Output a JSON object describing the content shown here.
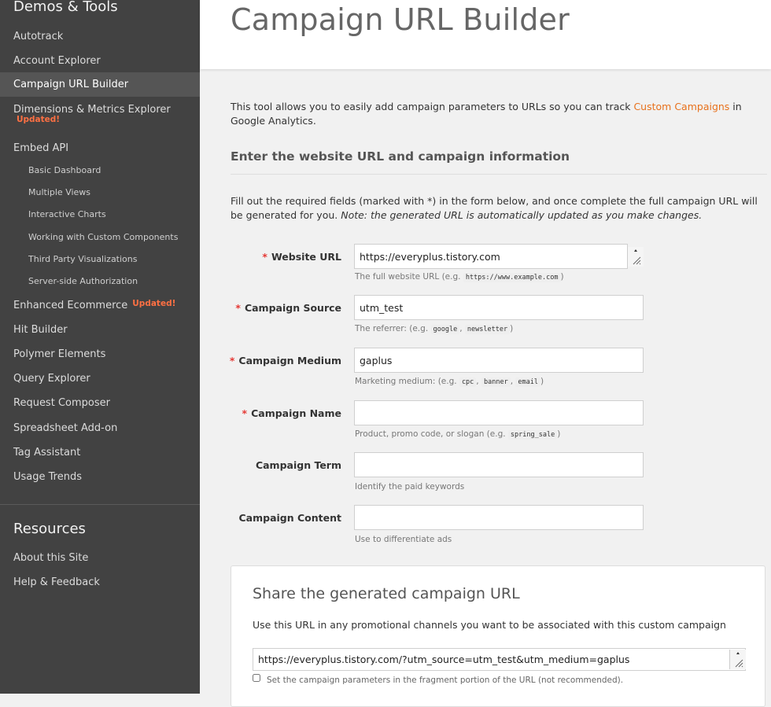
{
  "sidebar": {
    "demos_heading": "Demos & Tools",
    "items": {
      "autotrack": "Autotrack",
      "account_explorer": "Account Explorer",
      "campaign_url_builder": "Campaign URL Builder",
      "dimensions_metrics": "Dimensions & Metrics Explorer",
      "dimensions_badge": "Updated!",
      "embed_api": "Embed API",
      "enhanced_ecommerce": "Enhanced Ecommerce",
      "enhanced_badge": "Updated!",
      "hit_builder": "Hit Builder",
      "polymer_elements": "Polymer Elements",
      "query_explorer": "Query Explorer",
      "request_composer": "Request Composer",
      "spreadsheet_addon": "Spreadsheet Add-on",
      "tag_assistant": "Tag Assistant",
      "usage_trends": "Usage Trends"
    },
    "embed_sub": {
      "basic_dashboard": "Basic Dashboard",
      "multiple_views": "Multiple Views",
      "interactive_charts": "Interactive Charts",
      "custom_components": "Working with Custom Components",
      "third_party": "Third Party Visualizations",
      "server_side": "Server-side Authorization"
    },
    "resources_heading": "Resources",
    "resources": {
      "about": "About this Site",
      "help": "Help & Feedback"
    }
  },
  "header": {
    "title": "Campaign URL Builder"
  },
  "intro": {
    "text_before": "This tool allows you to easily add campaign parameters to URLs so you can track ",
    "link": "Custom Campaigns",
    "text_after": " in Google Analytics."
  },
  "form": {
    "heading": "Enter the website URL and campaign information",
    "instructions": "Fill out the required fields (marked with *) in the form below, and once complete the full campaign URL will be generated for you. ",
    "instructions_note": "Note: the generated URL is automatically updated as you make changes.",
    "required_mark": "*",
    "website_url": {
      "label": "Website URL",
      "value": "https://everyplus.tistory.com",
      "hint_prefix": "The full website URL (e.g. ",
      "hint_example": "https://www.example.com",
      "hint_suffix": ")"
    },
    "campaign_source": {
      "label": "Campaign Source",
      "value": "utm_test",
      "hint_prefix": "The referrer: (e.g. ",
      "hint_ex1": "google",
      "hint_sep": ", ",
      "hint_ex2": "newsletter",
      "hint_suffix": ")"
    },
    "campaign_medium": {
      "label": "Campaign Medium",
      "value": "gaplus",
      "hint_prefix": "Marketing medium: (e.g. ",
      "hint_ex1": "cpc",
      "hint_sep1": ", ",
      "hint_ex2": "banner",
      "hint_sep2": ", ",
      "hint_ex3": "email",
      "hint_suffix": ")"
    },
    "campaign_name": {
      "label": "Campaign Name",
      "value": "",
      "hint_prefix": "Product, promo code, or slogan (e.g. ",
      "hint_example": "spring_sale",
      "hint_suffix": ")"
    },
    "campaign_term": {
      "label": "Campaign Term",
      "value": "",
      "hint": "Identify the paid keywords"
    },
    "campaign_content": {
      "label": "Campaign Content",
      "value": "",
      "hint": "Use to differentiate ads"
    }
  },
  "share": {
    "title": "Share the generated campaign URL",
    "description": "Use this URL in any promotional channels you want to be associated with this custom campaign",
    "generated_url": "https://everyplus.tistory.com/?utm_source=utm_test&utm_medium=gaplus",
    "fragment_label": "Set the campaign parameters in the fragment portion of the URL (not recommended)."
  },
  "colors": {
    "sidebar_bg": "#424242",
    "accent_link": "#e8711c",
    "badge": "#ff7043",
    "required": "#e53935"
  }
}
